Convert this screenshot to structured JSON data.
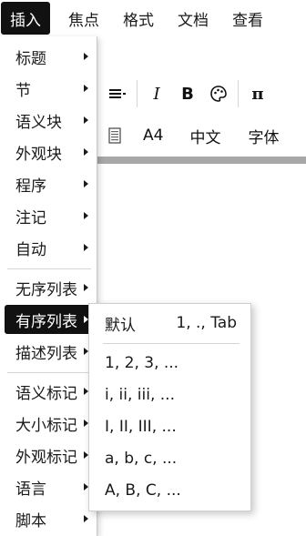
{
  "menubar": {
    "items": [
      "插入",
      "焦点",
      "格式",
      "文档",
      "查看"
    ]
  },
  "toolbar1": {
    "icons": [
      "align-lines-icon",
      "italic-icon",
      "bold-icon",
      "palette-icon",
      "pi-icon"
    ],
    "italic_glyph": "I",
    "bold_glyph": "B",
    "pi_glyph": "π"
  },
  "toolbar2": {
    "page_size": "A4",
    "language": "中文",
    "font": "字体"
  },
  "insert_menu": {
    "items": [
      {
        "label": "标题"
      },
      {
        "label": "节"
      },
      {
        "label": "语义块"
      },
      {
        "label": "外观块"
      },
      {
        "label": "程序"
      },
      {
        "label": "注记"
      },
      {
        "label": "自动"
      },
      {
        "label": "无序列表"
      },
      {
        "label": "有序列表"
      },
      {
        "label": "描述列表"
      },
      {
        "label": "语义标记"
      },
      {
        "label": "大小标记"
      },
      {
        "label": "外观标记"
      },
      {
        "label": "语言"
      },
      {
        "label": "脚本"
      }
    ],
    "highlighted": "有序列表"
  },
  "ordered_list_submenu": {
    "default_label": "默认",
    "default_shortcut": "1, ., Tab",
    "items": [
      {
        "label": "1, 2, 3, ..."
      },
      {
        "label": "i, ii, iii, ..."
      },
      {
        "label": "I, II, III, ..."
      },
      {
        "label": "a, b, c, ..."
      },
      {
        "label": "A, B, C, ..."
      }
    ]
  }
}
